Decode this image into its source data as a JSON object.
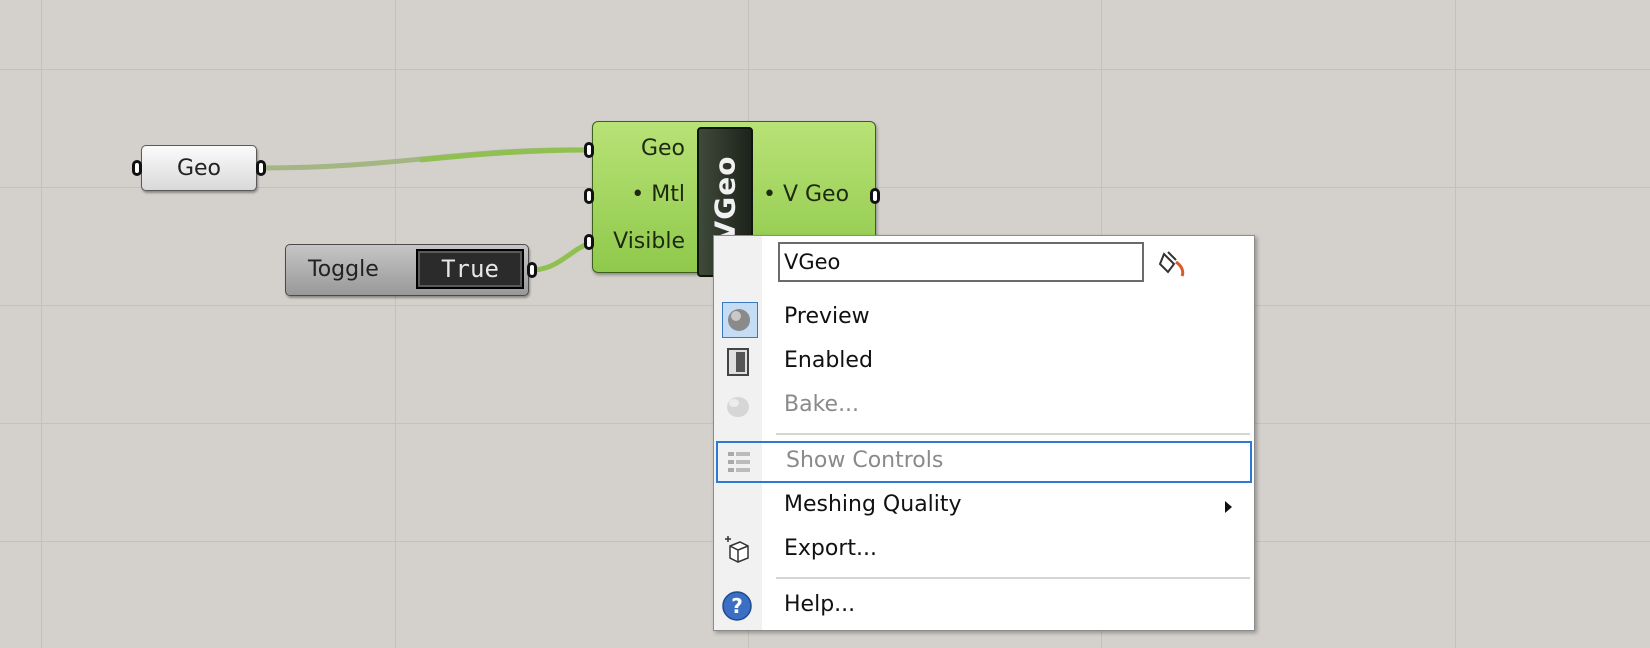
{
  "canvas": {
    "geo_param": {
      "label": "Geo"
    },
    "toggle": {
      "label": "Toggle",
      "value": "True"
    },
    "component": {
      "inputs": [
        "Geo",
        "• Mtl",
        "Visible"
      ],
      "nickname": "VGeo",
      "outputs": [
        "• V Geo"
      ]
    }
  },
  "context_menu": {
    "name_value": "VGeo",
    "items": [
      {
        "label": "Preview",
        "icon": "preview-icon",
        "checked": true,
        "enabled": true
      },
      {
        "label": "Enabled",
        "icon": "enabled-icon",
        "enabled": true
      },
      {
        "label": "Bake...",
        "icon": "bake-icon",
        "enabled": false
      },
      {
        "label": "Show Controls",
        "icon": "show-controls-icon",
        "enabled": false
      },
      {
        "label": "Meshing Quality",
        "icon": "",
        "enabled": true,
        "submenu": true
      },
      {
        "label": "Export...",
        "icon": "export-icon",
        "enabled": true
      },
      {
        "label": "Help...",
        "icon": "help-icon",
        "enabled": true
      }
    ]
  },
  "colors": {
    "canvas_bg": "#d4d1cc",
    "component_green": "#a3d65f",
    "wire_green": "#8fc050",
    "highlight_blue": "#2d7ad6"
  }
}
